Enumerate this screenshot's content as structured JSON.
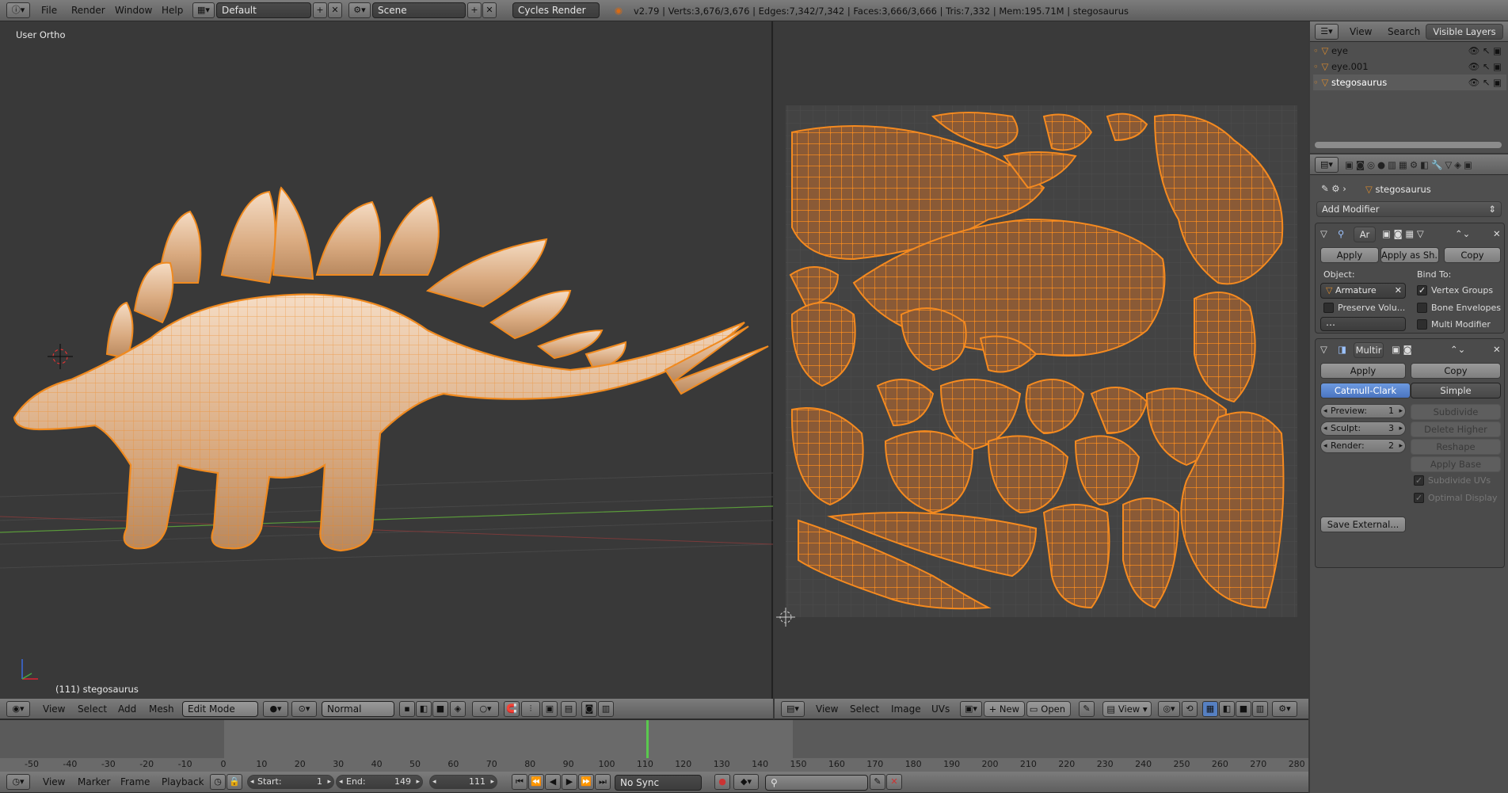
{
  "topbar": {
    "menus": [
      "File",
      "Render",
      "Window",
      "Help"
    ],
    "screen_layout": "Default",
    "scene": "Scene",
    "engine": "Cycles Render",
    "stats": "v2.79 | Verts:3,676/3,676 | Edges:7,342/7,342 | Faces:3,666/3,666 | Tris:7,332 | Mem:195.71M | stegosaurus"
  },
  "viewport3d": {
    "view_label": "User Ortho",
    "object_label": "(111) stegosaurus",
    "header_menus": [
      "View",
      "Select",
      "Add",
      "Mesh"
    ],
    "mode": "Edit Mode",
    "pivot": "Normal"
  },
  "uv_editor": {
    "header_menus": [
      "View",
      "Select",
      "Image",
      "UVs"
    ],
    "new_label": "New",
    "open_label": "Open",
    "view_label": "View"
  },
  "outliner": {
    "header_menus": [
      "View",
      "Search"
    ],
    "display_mode": "Visible Layers",
    "items": [
      "eye",
      "eye.001",
      "stegosaurus"
    ]
  },
  "properties": {
    "object_name": "stegosaurus",
    "add_modifier": "Add Modifier",
    "armature_mod": {
      "name": "Ar",
      "apply": "Apply",
      "apply_shape": "Apply as Sh...",
      "copy": "Copy",
      "object_label": "Object:",
      "object_value": "Armature",
      "bind_to_label": "Bind To:",
      "vertex_groups": "Vertex Groups",
      "preserve_volume": "Preserve Volu...",
      "bone_envelopes": "Bone Envelopes",
      "multi_modifier": "Multi Modifier"
    },
    "multires_mod": {
      "name": "Multir",
      "apply": "Apply",
      "copy": "Copy",
      "catmull": "Catmull-Clark",
      "simple": "Simple",
      "preview_label": "Preview:",
      "preview": "1",
      "sculpt_label": "Sculpt:",
      "sculpt": "3",
      "render_label": "Render:",
      "render": "2",
      "subdivide": "Subdivide",
      "delete_higher": "Delete Higher",
      "reshape": "Reshape",
      "apply_base": "Apply Base",
      "subdivide_uvs": "Subdivide UVs",
      "optimal_display": "Optimal Display",
      "save_external": "Save External..."
    }
  },
  "timeline": {
    "ticks": [
      "-50",
      "-40",
      "-30",
      "-20",
      "-10",
      "0",
      "10",
      "20",
      "30",
      "40",
      "50",
      "60",
      "70",
      "80",
      "90",
      "100",
      "110",
      "120",
      "130",
      "140",
      "150",
      "160",
      "170",
      "180",
      "190",
      "200",
      "210",
      "220",
      "230",
      "240",
      "250",
      "260",
      "270",
      "280"
    ],
    "menus": [
      "View",
      "Marker",
      "Frame",
      "Playback"
    ],
    "start_label": "Start:",
    "start": "1",
    "end_label": "End:",
    "end": "149",
    "current": "111",
    "sync": "No Sync"
  },
  "colors": {
    "accent_orange": "#f58a1f",
    "selected_blue": "#5680c2",
    "uv_fill": "#8a5a36"
  }
}
